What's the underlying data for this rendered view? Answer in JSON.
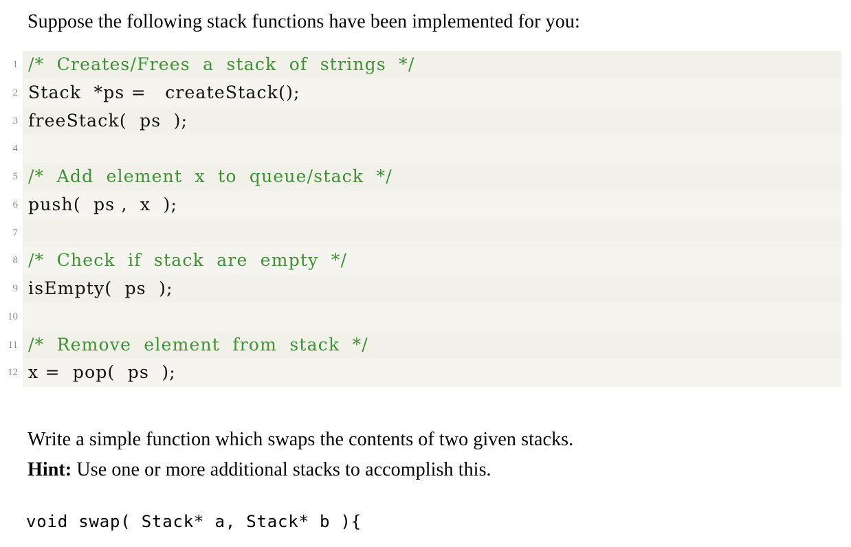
{
  "document": {
    "intro_paragraph": "Suppose the following stack functions have been implemented for you:",
    "task_paragraph": "Write a simple function which swaps the contents of two given stacks.",
    "hint_label": "Hint:",
    "hint_text": " Use one or more additional stacks to accomplish this.",
    "answer_stub": "void swap( Stack* a, Stack* b ){"
  },
  "colors": {
    "listing_background": "#F1F0E9",
    "comment_green": "#3E9134",
    "line_number_gray": "#8C8C8C",
    "body_text": "#000000",
    "page_background": "#FFFFFF"
  },
  "listing": {
    "lines": [
      {
        "num": "1",
        "text": "/*  Creates/Frees  a  stack  of  strings  */",
        "kind": "comment"
      },
      {
        "num": "2",
        "text": "Stack  *ps =   createStack();",
        "kind": "code"
      },
      {
        "num": "3",
        "text": "freeStack(  ps  );",
        "kind": "code"
      },
      {
        "num": "4",
        "text": "",
        "kind": "code"
      },
      {
        "num": "5",
        "text": "/*  Add  element  x  to  queue/stack  */",
        "kind": "comment"
      },
      {
        "num": "6",
        "text": "push(  ps ,  x  );",
        "kind": "code"
      },
      {
        "num": "7",
        "text": "",
        "kind": "code"
      },
      {
        "num": "8",
        "text": "/*  Check  if  stack  are  empty  */",
        "kind": "comment"
      },
      {
        "num": "9",
        "text": "isEmpty(  ps  );",
        "kind": "code"
      },
      {
        "num": "10",
        "text": "",
        "kind": "code"
      },
      {
        "num": "11",
        "text": "/*  Remove  element  from  stack  */",
        "kind": "comment"
      },
      {
        "num": "12",
        "text": "x =  pop(  ps  );",
        "kind": "code"
      }
    ]
  }
}
